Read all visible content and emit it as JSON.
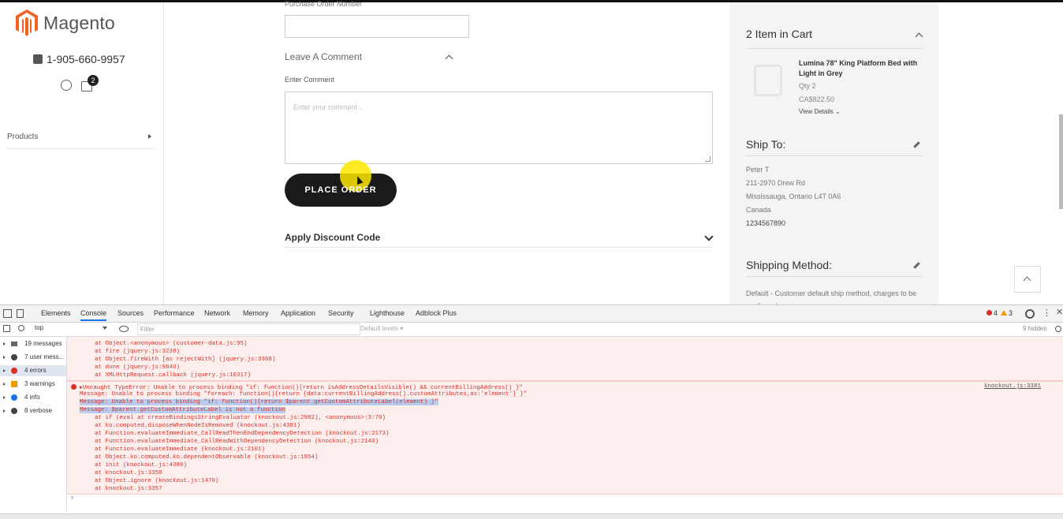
{
  "brand": {
    "name": "Magento",
    "accent": "#f26322"
  },
  "header": {
    "phone": "1-905-660-9957",
    "cart_count": "2"
  },
  "sidebar": {
    "products_label": "Products"
  },
  "form": {
    "po_label": "Purchase Order Number",
    "comment_section": "Leave A Comment",
    "comment_label": "Enter Comment",
    "comment_placeholder": "Enter your comment...",
    "place_order": "PLACE ORDER",
    "discount": "Apply Discount Code"
  },
  "summary": {
    "items_in_cart": "2 Item in Cart",
    "product_name": "Lumina 78\" King Platform Bed with Light in Grey",
    "qty": "Qty 2",
    "price": "CA$822.50",
    "view_details": "View Details",
    "ship_to": "Ship To:",
    "address": [
      "Peter T",
      "211-2970 Drew Rd",
      "Mississauga, Ontario L4T 0A6",
      "Canada",
      "1234567890"
    ],
    "shipping_method": "Shipping Method:",
    "shipping_method_text": "Default - Customer default ship method, charges to be confirmed"
  },
  "devtools": {
    "tabs": [
      "Elements",
      "Console",
      "Sources",
      "Performance",
      "Network",
      "Memory",
      "Application",
      "Security",
      "Lighthouse",
      "Adblock Plus"
    ],
    "active_tab": "Console",
    "errors": "4",
    "warnings": "3",
    "context": "top",
    "filter_placeholder": "Filter",
    "levels": "Default levels",
    "hidden": "9 hidden",
    "sidebar": [
      {
        "label": "19 messages",
        "color": "#666"
      },
      {
        "label": "7 user mess...",
        "color": "#444"
      },
      {
        "label": "4 errors",
        "color": "#d93025"
      },
      {
        "label": "3 warnings",
        "color": "#f29900"
      },
      {
        "label": "4 info",
        "color": "#1a73e8"
      },
      {
        "label": "8 verbose",
        "color": "#444"
      }
    ],
    "block1": [
      "at Object.<anonymous> (customer-data.js:95)",
      "at fire (jquery.js:3238)",
      "at Object.fireWith [as rejectWith] (jquery.js:3368)",
      "at done (jquery.js:9840)",
      "at XMLHttpRequest.callback (jquery.js:10317)"
    ],
    "block2": [
      "▸Uncaught TypeError: Unable to process binding \"if: function(){return isAddressDetailsVisible() && currentBillingAddress() }\"",
      "Message: Unable to process binding \"foreach: function(){return {data:currentBillingAddress().customAttributes,as:'element'} }\"",
      "Message: Unable to process binding \"if: function(){return $parent.getCustomAttributeLabel(element) }\"",
      "Message: $parent.getCustomAttributeLabel is not a function",
      "at if (eval at createBindingsStringEvaluator (knockout.js:2982), <anonymous>:3:70)",
      "at ko.computed.disposeWhenNodeIsRemoved (knockout.js:4381)",
      "at Function.evaluateImmediate_CallReadThenEndDependencyDetection (knockout.js:2173)",
      "at Function.evaluateImmediate_CallReadWithDependencyDetection (knockout.js:2140)",
      "at Function.evaluateImmediate (knockout.js:2101)",
      "at Object.ko.computed.ko.dependentObservable (knockout.js:1954)",
      "at init (knockout.js:4380)",
      "at knockout.js:3358",
      "at Object.ignore (knockout.js:1470)",
      "at knockout.js:3357"
    ],
    "source_link": "knockout.js:3381",
    "prompt": "›"
  }
}
